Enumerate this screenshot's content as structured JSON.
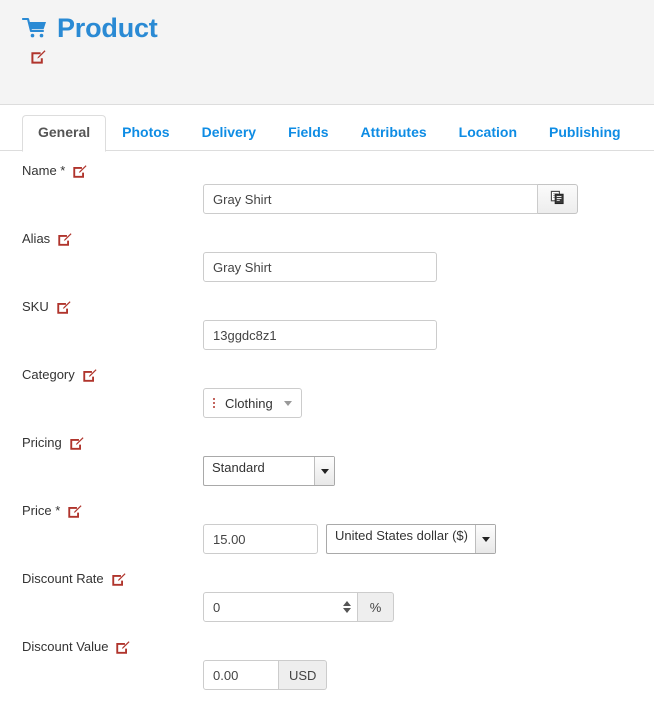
{
  "header": {
    "title": "Product",
    "cart_icon": "shopping-cart-icon",
    "edit_icon": "edit-pencil-icon",
    "accent_color": "#2a8ad4",
    "edit_icon_color": "#b0342c",
    "band_color": "#f4f4f4"
  },
  "tabs": [
    {
      "label": "General",
      "active": true
    },
    {
      "label": "Photos",
      "active": false
    },
    {
      "label": "Delivery",
      "active": false
    },
    {
      "label": "Fields",
      "active": false
    },
    {
      "label": "Attributes",
      "active": false
    },
    {
      "label": "Location",
      "active": false
    },
    {
      "label": "Publishing",
      "active": false
    }
  ],
  "form": {
    "name": {
      "label": "Name *",
      "value": "Gray Shirt",
      "placeholder": "",
      "button_icon": "copy-icon"
    },
    "alias": {
      "label": "Alias",
      "value": "Gray Shirt",
      "placeholder": ""
    },
    "sku": {
      "label": "SKU",
      "value": "13ggdc8z1",
      "placeholder": ""
    },
    "category": {
      "label": "Category",
      "value": "Clothing"
    },
    "pricing": {
      "label": "Pricing",
      "value": "Standard"
    },
    "price": {
      "label": "Price *",
      "value": "15.00",
      "currency": "United States dollar ($)"
    },
    "discount_rate": {
      "label": "Discount Rate",
      "value": "0",
      "addon": "%"
    },
    "discount_value": {
      "label": "Discount Value",
      "value": "0.00",
      "addon": "USD"
    }
  }
}
